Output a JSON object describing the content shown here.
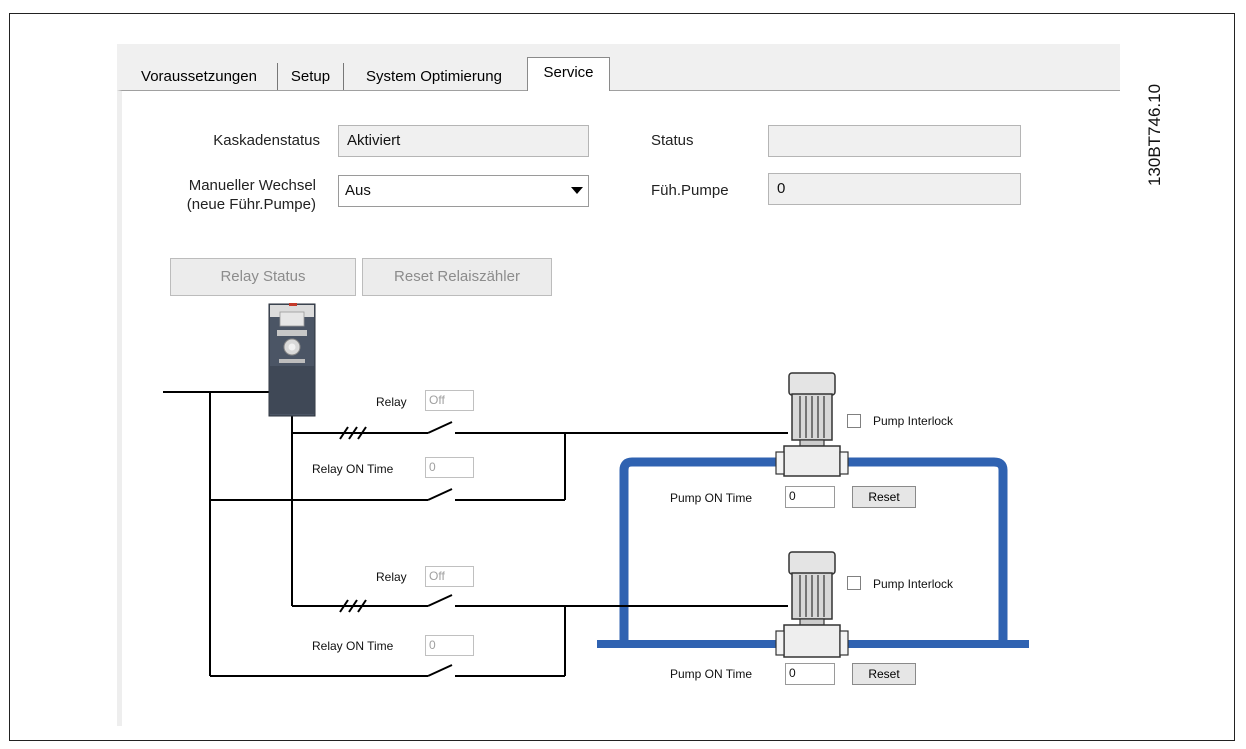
{
  "doc_id": "130BT746.10",
  "tabs": [
    {
      "label": "Voraussetzungen"
    },
    {
      "label": "Setup"
    },
    {
      "label": "System Optimierung"
    },
    {
      "label": "Service",
      "active": true
    }
  ],
  "form": {
    "kaskadenstatus_label": "Kaskadenstatus",
    "kaskadenstatus_value": "Aktiviert",
    "manueller_label_1": "Manueller Wechsel",
    "manueller_label_2": "(neue Führ.Pumpe)",
    "manueller_value": "Aus",
    "status_label": "Status",
    "status_value": "",
    "fuehpumpe_label": "Füh.Pumpe",
    "fuehpumpe_value": "0"
  },
  "buttons": {
    "relay_status": "Relay Status",
    "reset_relaiszaehler": "Reset Relaiszähler"
  },
  "relays": [
    {
      "relay_label": "Relay",
      "relay_value": "Off",
      "on_time_label": "Relay ON Time",
      "on_time_value": "0"
    },
    {
      "relay_label": "Relay",
      "relay_value": "Off",
      "on_time_label": "Relay ON Time",
      "on_time_value": "0"
    }
  ],
  "pumps": [
    {
      "interlock_label": "Pump Interlock",
      "on_time_label": "Pump ON Time",
      "on_time_value": "0",
      "reset_label": "Reset"
    },
    {
      "interlock_label": "Pump Interlock",
      "on_time_label": "Pump ON Time",
      "on_time_value": "0",
      "reset_label": "Reset"
    }
  ],
  "colors": {
    "pipe": "#2f62b1",
    "drive_body": "#4b5565",
    "drive_top": "#dcdcdc"
  }
}
